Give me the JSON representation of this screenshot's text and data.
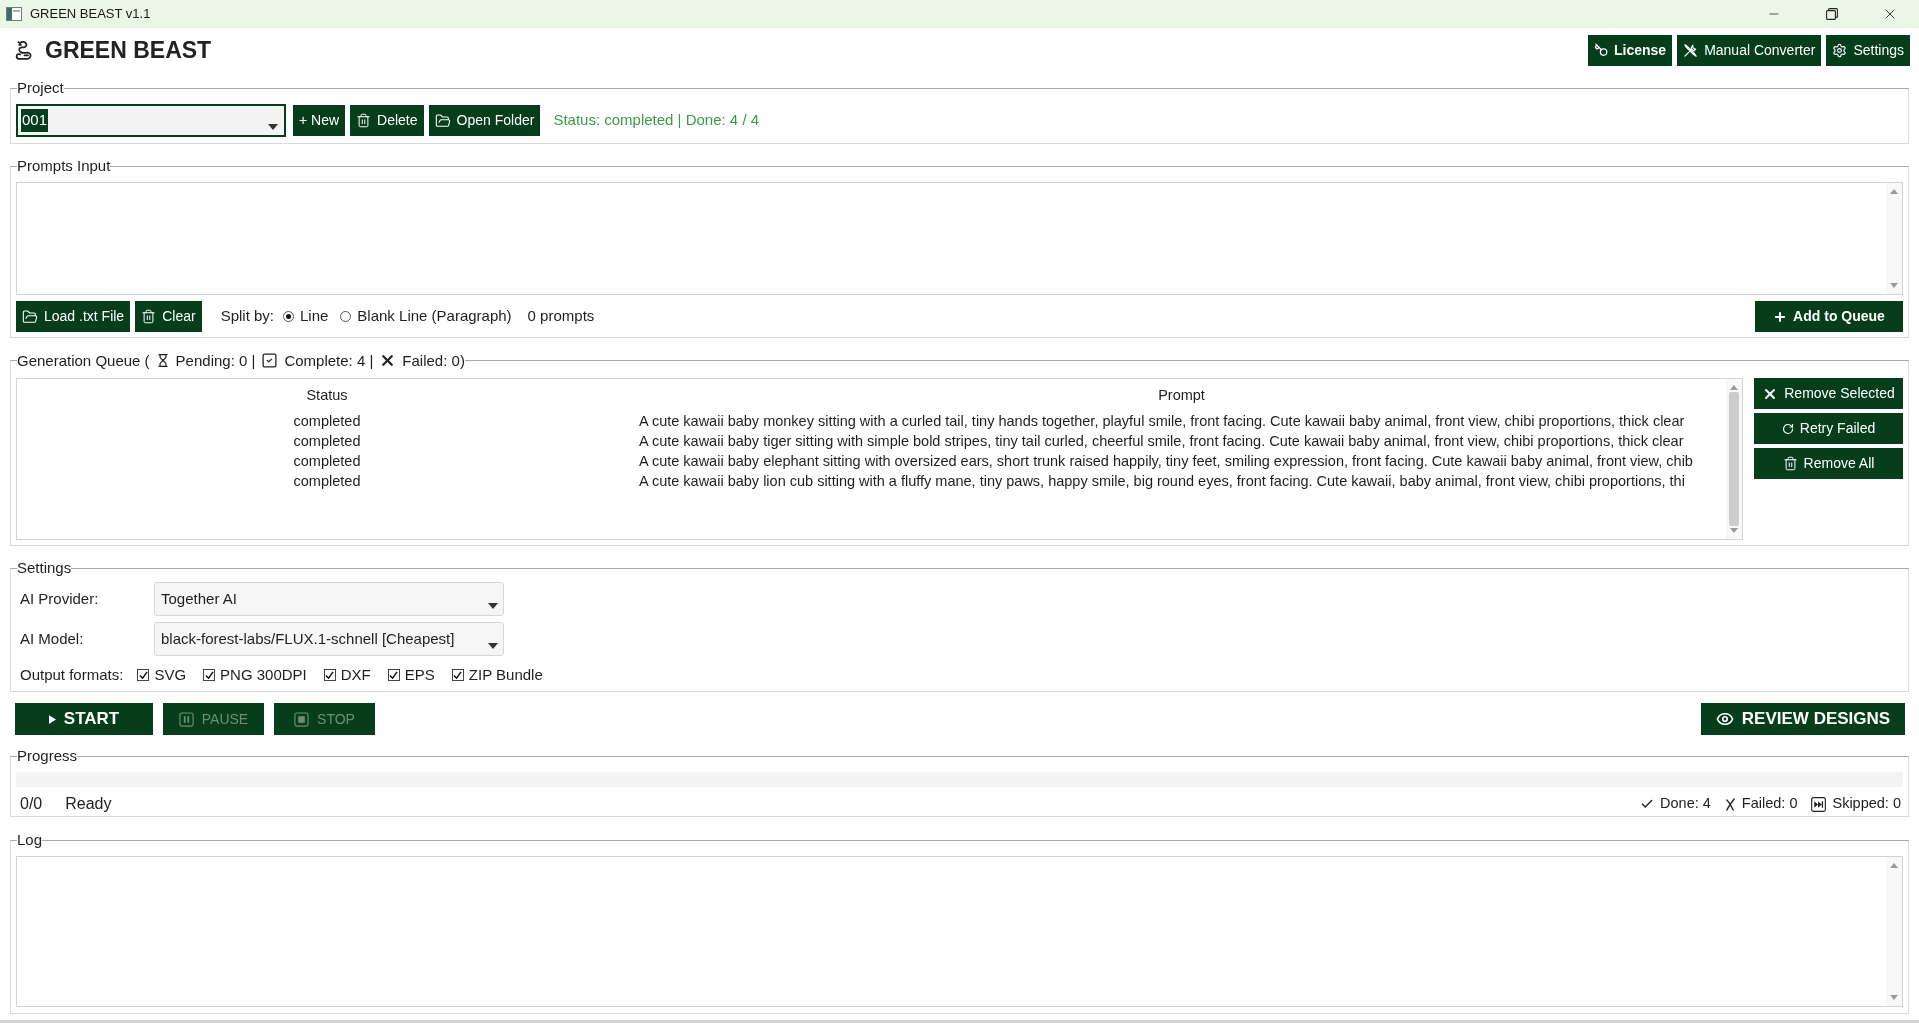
{
  "window": {
    "title": "GREEN BEAST v1.1"
  },
  "header": {
    "app_name": "GREEN BEAST",
    "buttons": [
      {
        "label": "License",
        "bold": true
      },
      {
        "label": "Manual Converter",
        "bold": false
      },
      {
        "label": "Settings",
        "bold": false
      }
    ]
  },
  "project": {
    "label": "Project",
    "combo": {
      "value": "001",
      "text_selected": true
    },
    "buttons": [
      {
        "label": "+ New"
      },
      {
        "label": "Delete"
      },
      {
        "label": "Open Folder"
      }
    ],
    "status": "Status: completed | Done: 4 / 4"
  },
  "prompts": {
    "label": "Prompts Input",
    "buttons": [
      {
        "label": "Load .txt File"
      },
      {
        "label": "Clear"
      }
    ],
    "split": {
      "label": "Split by:",
      "options": [
        {
          "label": "Line",
          "selected": true
        },
        {
          "label": "Blank Line (Paragraph)",
          "selected": false
        }
      ]
    },
    "count": "0 prompts",
    "add_button": "Add to Queue"
  },
  "queue": {
    "label": "Generation Queue (",
    "counters": [
      "Pending: 0 |",
      "Complete: 4 |",
      "Failed: 0)"
    ],
    "columns": [
      "Status",
      "Prompt"
    ],
    "rows": [
      {
        "status": "completed",
        "prompt": "A cute kawaii baby monkey sitting with a curled tail, tiny hands together, playful smile, front facing. Cute kawaii baby animal, front view, chibi proportions, thick clear",
        "selected": false
      },
      {
        "status": "completed",
        "prompt": "A cute kawaii baby tiger sitting with simple bold stripes, tiny tail curled, cheerful smile, front facing. Cute kawaii baby animal, front view, chibi proportions, thick clear",
        "selected": false
      },
      {
        "status": "completed",
        "prompt": "A cute kawaii baby elephant sitting with oversized ears, short trunk raised happily, tiny feet, smiling expression, front facing. Cute kawaii baby animal, front view, chib",
        "selected": false
      },
      {
        "status": "completed",
        "prompt": "A cute kawaii baby lion cub sitting with a fluffy mane, tiny paws, happy smile, big round eyes, front facing. Cute kawaii, baby animal, front view, chibi proportions, thi",
        "selected": false
      }
    ],
    "buttons": [
      "Remove Selected",
      "Retry Failed",
      "Remove All"
    ]
  },
  "settings": {
    "label": "Settings",
    "fields": [
      {
        "label": "AI Provider:",
        "value": "Together AI"
      },
      {
        "label": "AI Model:",
        "value": "black-forest-labs/FLUX.1-schnell [Cheapest]"
      }
    ],
    "output_formats": {
      "label": "Output formats:",
      "options": [
        {
          "label": "SVG",
          "checked": true
        },
        {
          "label": "PNG 300DPI",
          "checked": true
        },
        {
          "label": "DXF",
          "checked": true
        },
        {
          "label": "EPS",
          "checked": true
        },
        {
          "label": "ZIP Bundle",
          "checked": true
        }
      ]
    }
  },
  "controls": {
    "buttons": [
      {
        "label": "START",
        "disabled": false
      },
      {
        "label": "PAUSE",
        "disabled": true
      },
      {
        "label": "STOP",
        "disabled": true
      }
    ],
    "review_button": "REVIEW DESIGNS"
  },
  "progress": {
    "label": "Progress",
    "level": 0,
    "count": "0/0",
    "status": "Ready",
    "stats": [
      "Done: 4",
      "Failed: 0",
      "Skipped: 0"
    ]
  },
  "log": {
    "label": "Log"
  }
}
